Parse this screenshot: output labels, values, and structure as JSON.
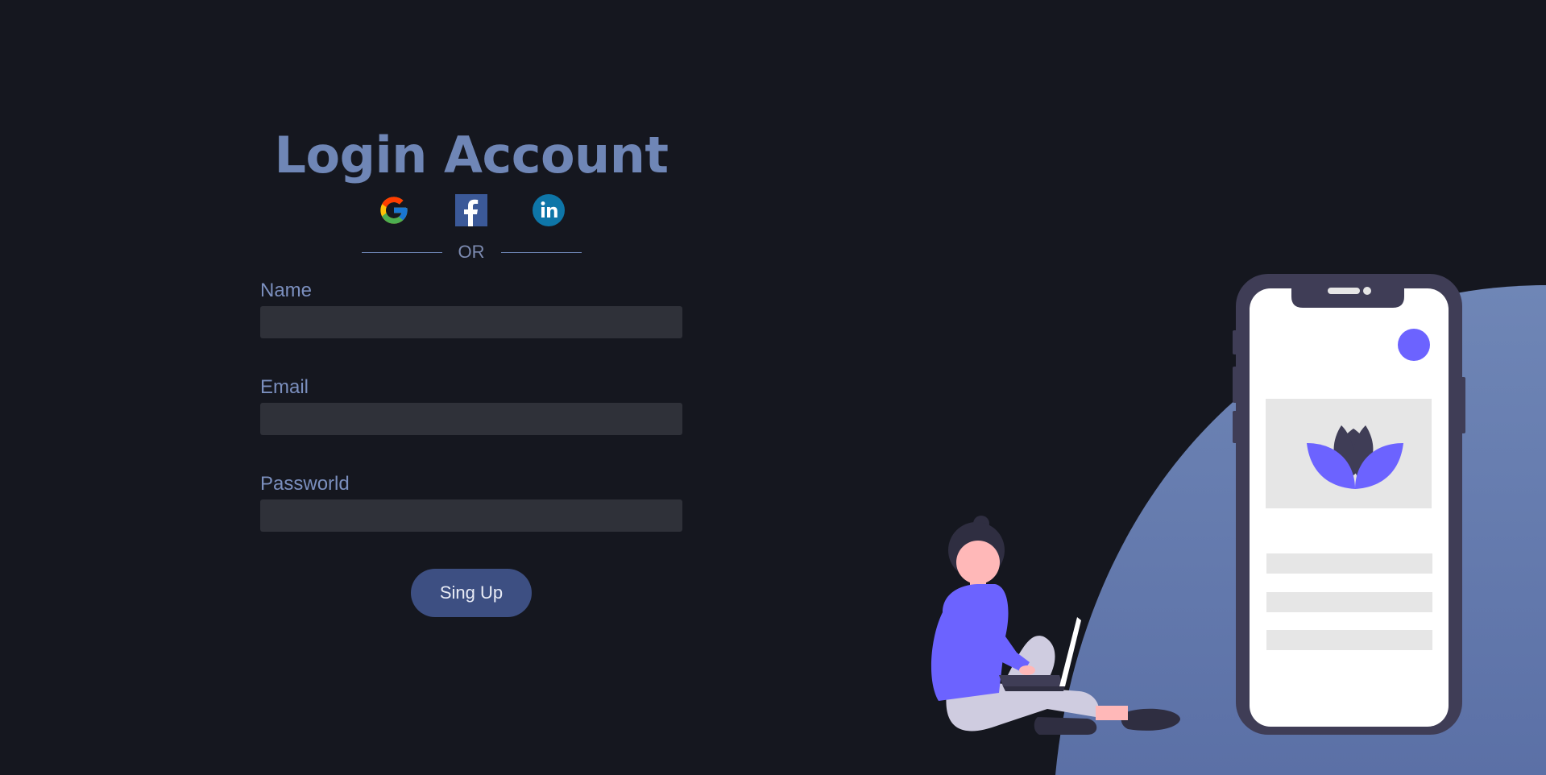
{
  "form": {
    "title": "Login Account",
    "social": {
      "google": "Google",
      "facebook": "Facebook",
      "linkedin": "LinkedIn"
    },
    "divider_text": "OR",
    "fields": [
      {
        "label": "Name",
        "value": "",
        "placeholder": ""
      },
      {
        "label": "Email",
        "value": "",
        "placeholder": ""
      },
      {
        "label": "Passworld",
        "value": "",
        "placeholder": ""
      }
    ],
    "submit_label": "Sing Up"
  },
  "icons": {
    "google": "google-icon",
    "facebook": "facebook-icon",
    "linkedin": "linkedin-icon"
  },
  "colors": {
    "background": "#15171f",
    "title": "#6f86b6",
    "label": "#7b8fbe",
    "input_bg": "#2f3139",
    "button_bg": "#3d4f82",
    "blob": "#6a80b3",
    "accent": "#6c63ff"
  }
}
